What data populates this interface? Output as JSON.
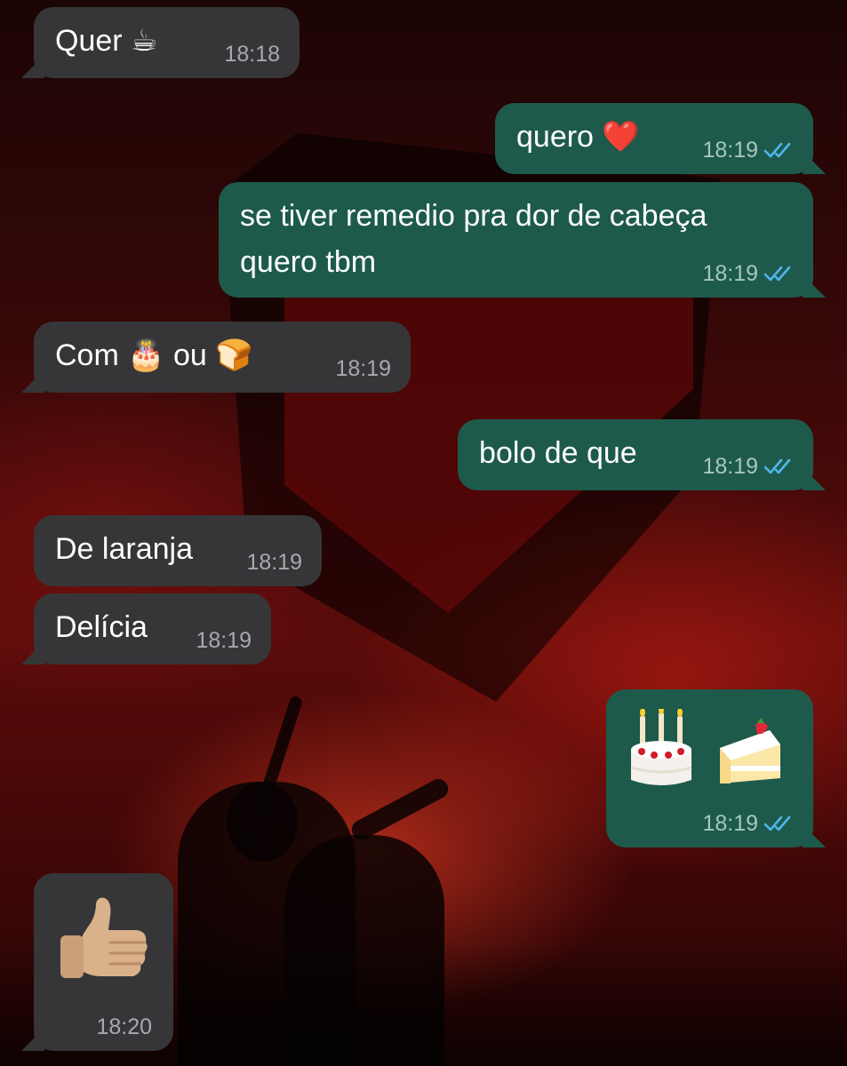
{
  "colors": {
    "incoming_bubble": "#363638",
    "outgoing_bubble": "#1d5a4b",
    "read_ticks": "#4fb6ec",
    "time_incoming": "#a8a8ad",
    "time_outgoing": "#a8c6bd"
  },
  "messages": [
    {
      "direction": "in",
      "text": "Quer ☕",
      "time": "18:18"
    },
    {
      "direction": "out",
      "text": "quero ❤️",
      "time": "18:19",
      "status": "read"
    },
    {
      "direction": "out",
      "text": "se tiver remedio pra dor de cabeça quero tbm",
      "time": "18:19",
      "status": "read"
    },
    {
      "direction": "in",
      "text": "Com 🎂 ou 🍞",
      "time": "18:19"
    },
    {
      "direction": "out",
      "text": "bolo de que",
      "time": "18:19",
      "status": "read"
    },
    {
      "direction": "in",
      "text": "De laranja",
      "time": "18:19"
    },
    {
      "direction": "in",
      "text": "Delícia",
      "time": "18:19"
    },
    {
      "direction": "out",
      "text": "🎂 🍰",
      "time": "18:19",
      "status": "read",
      "icons": [
        "birthday-cake-icon",
        "shortcake-slice-icon"
      ]
    },
    {
      "direction": "in",
      "text": "👍🏼",
      "time": "18:20",
      "icons": [
        "thumbs-up-icon"
      ]
    }
  ]
}
